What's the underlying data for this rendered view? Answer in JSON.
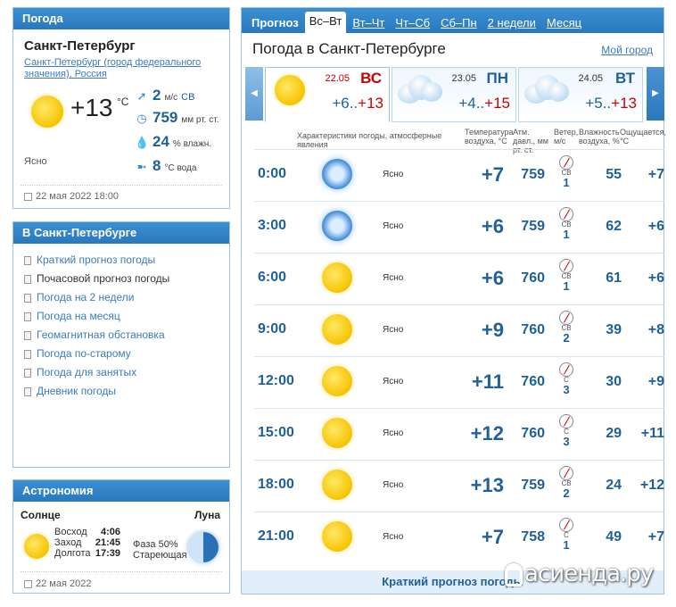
{
  "weather": {
    "header": "Погода",
    "city": "Санкт-Петербург",
    "city_sub": "Санкт-Петербург (город федерального значения), Россия",
    "temp": "+13",
    "temp_unit": "°C",
    "desc": "Ясно",
    "wind_value": "2",
    "wind_unit": "м/с",
    "wind_dir": "СВ",
    "pressure_value": "759",
    "pressure_unit": "мм рт. ст.",
    "humidity_value": "24",
    "humidity_unit": "% влажн.",
    "water_value": "8",
    "water_unit": "°С вода",
    "updated": "22 мая 2022 18:00"
  },
  "links": {
    "header": "В Санкт-Петербурге",
    "items": [
      {
        "label": "Краткий прогноз погоды"
      },
      {
        "label": "Почасовой прогноз погоды",
        "current": true
      },
      {
        "label": "Погода на 2 недели"
      },
      {
        "label": "Погода на месяц"
      },
      {
        "label": "Геомагнитная обстановка"
      },
      {
        "label": "Погода по-старому"
      },
      {
        "label": "Погода для занятых"
      },
      {
        "label": "Дневник погоды"
      }
    ]
  },
  "astronomy": {
    "header": "Астрономия",
    "sun_label": "Солнце",
    "moon_label": "Луна",
    "rise_label": "Восход",
    "rise": "4:06",
    "set_label": "Заход",
    "set": "21:45",
    "length_label": "Долгота",
    "length": "17:39",
    "phase_label": "Фаза 50%",
    "phase_desc": "Стареющая",
    "date": "22 мая 2022"
  },
  "main": {
    "tabs": [
      {
        "label": "Прогноз",
        "kind": "first"
      },
      {
        "label": "Вс–Вт",
        "kind": "active"
      },
      {
        "label": "Вт–Чт",
        "kind": "link"
      },
      {
        "label": "Чт–Сб",
        "kind": "link"
      },
      {
        "label": "Сб–Пн",
        "kind": "link"
      },
      {
        "label": "2 недели",
        "kind": "link"
      },
      {
        "label": "Месяц",
        "kind": "link"
      }
    ],
    "title": "Погода в Санкт-Петербурге",
    "my_city": "Мой город",
    "days": [
      {
        "date": "22.05",
        "dow": "ВС",
        "lo": "+6",
        "hi": "+13",
        "icon": "sun-icon"
      },
      {
        "date": "23.05",
        "dow": "ПН",
        "lo": "+4",
        "hi": "+15",
        "icon": "cloud-rain-icon"
      },
      {
        "date": "24.05",
        "dow": "ВТ",
        "lo": "+5",
        "hi": "+13",
        "icon": "cloud-icon"
      }
    ],
    "columns": {
      "conditions": "Характеристики погоды, атмосферные явления",
      "temp": "Температура воздуха, °С",
      "pressure": "Атм. давл., мм рт. ст.",
      "wind": "Ветер, м/с",
      "humidity": "Влажность воздуха, %",
      "feels": "Ощущается, °С"
    },
    "rows": [
      {
        "time": "0:00",
        "icon": "moon",
        "desc": "Ясно",
        "temp": "+7",
        "press": "759",
        "dir": "СВ",
        "speed": "1",
        "hum": "55",
        "feel": "+7"
      },
      {
        "time": "3:00",
        "icon": "moon",
        "desc": "Ясно",
        "temp": "+6",
        "press": "759",
        "dir": "СВ",
        "speed": "1",
        "hum": "62",
        "feel": "+6"
      },
      {
        "time": "6:00",
        "icon": "sun",
        "desc": "Ясно",
        "temp": "+6",
        "press": "760",
        "dir": "СВ",
        "speed": "1",
        "hum": "61",
        "feel": "+6"
      },
      {
        "time": "9:00",
        "icon": "sun",
        "desc": "Ясно",
        "temp": "+9",
        "press": "760",
        "dir": "СВ",
        "speed": "2",
        "hum": "39",
        "feel": "+8"
      },
      {
        "time": "12:00",
        "icon": "sun",
        "desc": "Ясно",
        "temp": "+11",
        "press": "760",
        "dir": "С",
        "speed": "3",
        "hum": "30",
        "feel": "+9"
      },
      {
        "time": "15:00",
        "icon": "sun",
        "desc": "Ясно",
        "temp": "+12",
        "press": "760",
        "dir": "С",
        "speed": "3",
        "hum": "29",
        "feel": "+11"
      },
      {
        "time": "18:00",
        "icon": "sun",
        "desc": "Ясно",
        "temp": "+13",
        "press": "759",
        "dir": "СВ",
        "speed": "2",
        "hum": "24",
        "feel": "+12"
      },
      {
        "time": "21:00",
        "icon": "sun",
        "desc": "Ясно",
        "temp": "+7",
        "press": "758",
        "dir": "С",
        "speed": "1",
        "hum": "49",
        "feel": "+7"
      }
    ],
    "footer_link": "Краткий прогноз погоды"
  },
  "watermark": "асиенда.ру"
}
